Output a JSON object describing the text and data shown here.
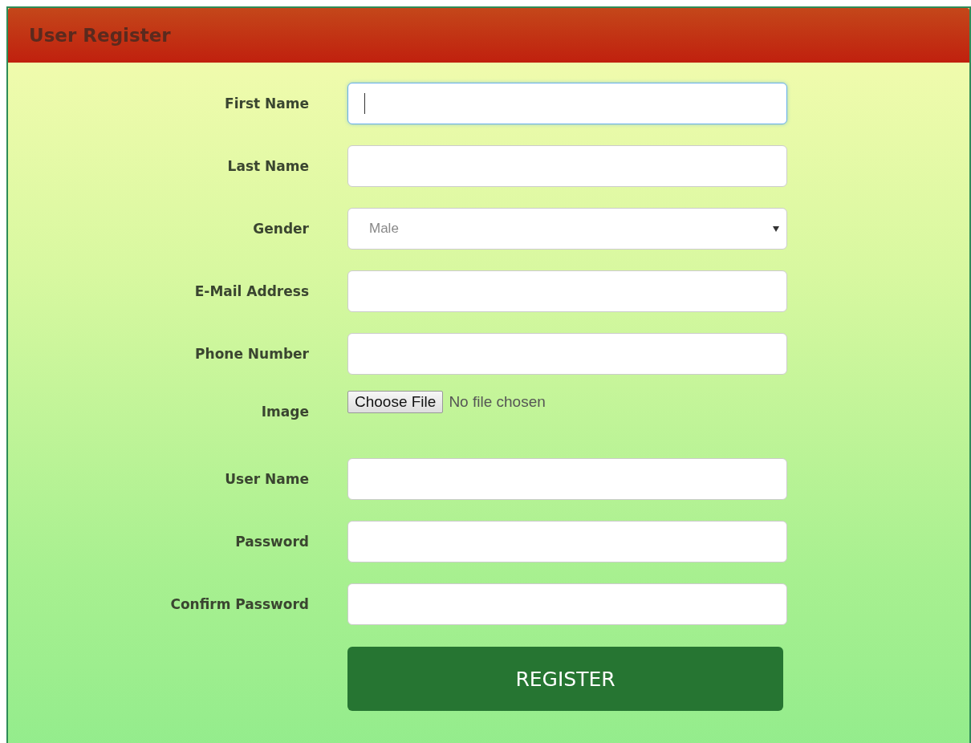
{
  "panel": {
    "title": "User Register"
  },
  "fields": [
    {
      "kind": "text",
      "label": "First Name",
      "focused": true
    },
    {
      "kind": "text",
      "label": "Last Name",
      "focused": false
    },
    {
      "kind": "select",
      "label": "Gender",
      "value": "Male",
      "focused": false
    },
    {
      "kind": "text",
      "label": "E-Mail Address",
      "focused": false
    },
    {
      "kind": "text",
      "label": "Phone Number",
      "focused": false
    },
    {
      "kind": "file",
      "label": "Image",
      "button": "Choose File",
      "status": "No file chosen",
      "focused": false
    },
    {
      "kind": "text",
      "label": "User Name",
      "focused": false
    },
    {
      "kind": "text",
      "label": "Password",
      "focused": false
    },
    {
      "kind": "text",
      "label": "Confirm Password",
      "focused": false
    }
  ],
  "submit": {
    "label": "REGISTER"
  }
}
